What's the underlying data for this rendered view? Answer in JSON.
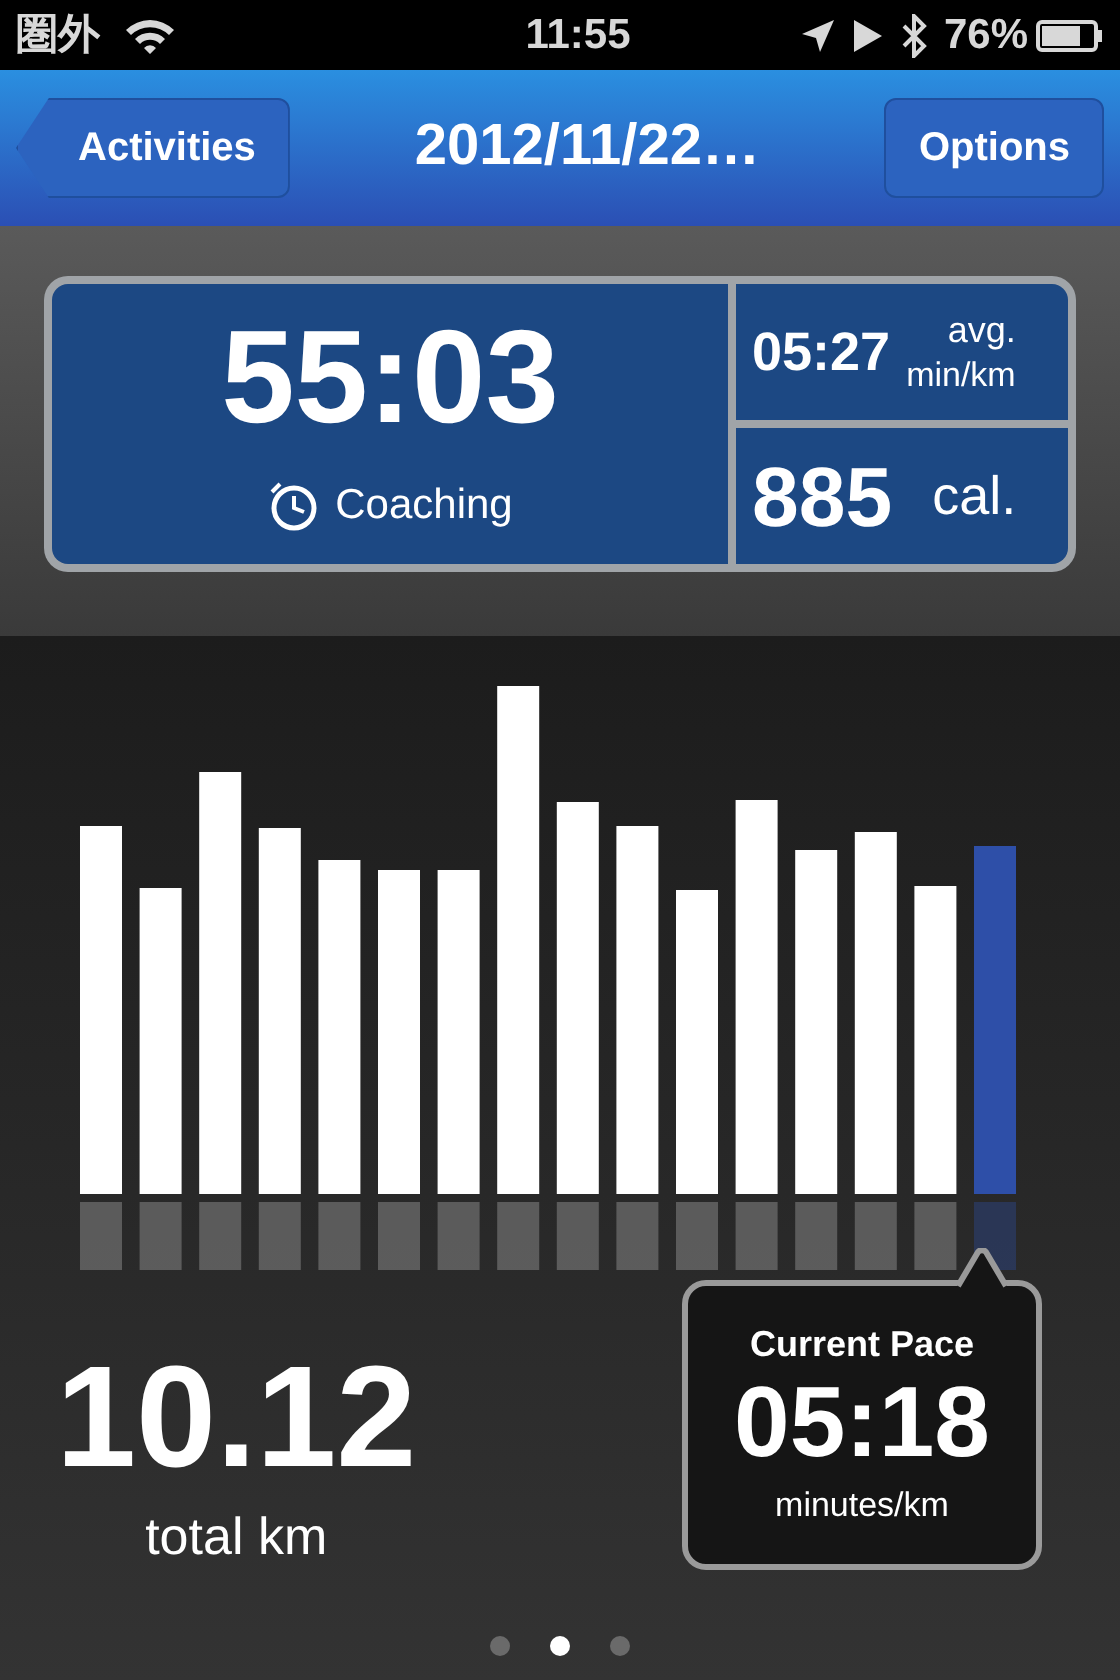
{
  "status_bar": {
    "carrier": "圏外",
    "time": "11:55",
    "battery": "76%"
  },
  "nav_bar": {
    "back_button": "Activities",
    "title": "2012/11/22…",
    "options_button": "Options"
  },
  "summary": {
    "duration": "55:03",
    "coaching": "Coaching",
    "avg_pace": "05:27",
    "avg_label_1": "avg.",
    "avg_label_2": "min/km",
    "calories": "885",
    "calories_unit": "cal."
  },
  "distance": {
    "value": "10.12",
    "unit": "total km"
  },
  "current_pace": {
    "title": "Current Pace",
    "value": "05:18",
    "unit": "minutes/km"
  },
  "page_dots": [
    {
      "selected": false
    },
    {
      "selected": true
    },
    {
      "selected": false
    }
  ]
}
